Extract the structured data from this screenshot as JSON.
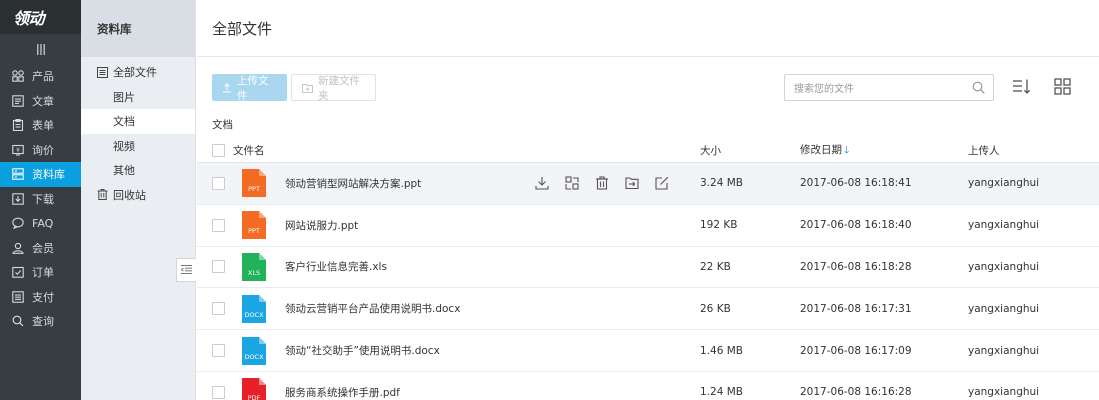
{
  "app": {
    "logo": "领动"
  },
  "nav": {
    "collapse_icon": "menu-bars-icon",
    "items": [
      {
        "label": "产品",
        "icon": "grid-icon"
      },
      {
        "label": "文章",
        "icon": "article-icon"
      },
      {
        "label": "表单",
        "icon": "form-icon"
      },
      {
        "label": "询价",
        "icon": "inquiry-icon"
      },
      {
        "label": "资料库",
        "icon": "library-icon",
        "active": true
      },
      {
        "label": "下载",
        "icon": "download-icon"
      },
      {
        "label": "FAQ",
        "icon": "faq-icon"
      },
      {
        "label": "会员",
        "icon": "member-icon"
      },
      {
        "label": "订单",
        "icon": "order-icon"
      },
      {
        "label": "支付",
        "icon": "payment-icon"
      },
      {
        "label": "查询",
        "icon": "search-icon"
      }
    ]
  },
  "sub": {
    "title": "资料库",
    "items": [
      {
        "label": "全部文件"
      },
      {
        "label": "图片"
      },
      {
        "label": "文档",
        "active": true
      },
      {
        "label": "视频"
      },
      {
        "label": "其他"
      },
      {
        "label": "回收站"
      }
    ]
  },
  "main": {
    "title": "全部文件",
    "toolbar": {
      "upload_label": "上传文件",
      "new_folder_label": "新建文件夹",
      "search_placeholder": "搜索您的文件"
    },
    "breadcrumb": "文档",
    "columns": {
      "name": "文件名",
      "size": "大小",
      "date": "修改日期",
      "owner": "上传人"
    },
    "files": [
      {
        "name": "领动营销型网站解决方案.ppt",
        "type": "PPT",
        "size": "3.24 MB",
        "date": "2017-06-08 16:18:41",
        "owner": "yangxianghui"
      },
      {
        "name": "网站说服力.ppt",
        "type": "PPT",
        "size": "192 KB",
        "date": "2017-06-08 16:18:40",
        "owner": "yangxianghui"
      },
      {
        "name": "客户行业信息完善.xls",
        "type": "XLS",
        "size": "22 KB",
        "date": "2017-06-08 16:18:28",
        "owner": "yangxianghui"
      },
      {
        "name": "领动云营销平台产品使用说明书.docx",
        "type": "DOCX",
        "size": "26 KB",
        "date": "2017-06-08 16:17:31",
        "owner": "yangxianghui"
      },
      {
        "name": "领动“社交助手”使用说明书.docx",
        "type": "DOCX",
        "size": "1.46 MB",
        "date": "2017-06-08 16:17:09",
        "owner": "yangxianghui"
      },
      {
        "name": "服务商系统操作手册.pdf",
        "type": "PDF",
        "size": "1.24 MB",
        "date": "2017-06-08 16:16:28",
        "owner": "yangxianghui"
      }
    ]
  },
  "colors": {
    "accent": "#0a9fde",
    "nav_bg": "#373d41",
    "ppt": "#f46b23",
    "xls": "#21b25a",
    "docx": "#1aa6e2",
    "pdf": "#e8202a"
  }
}
